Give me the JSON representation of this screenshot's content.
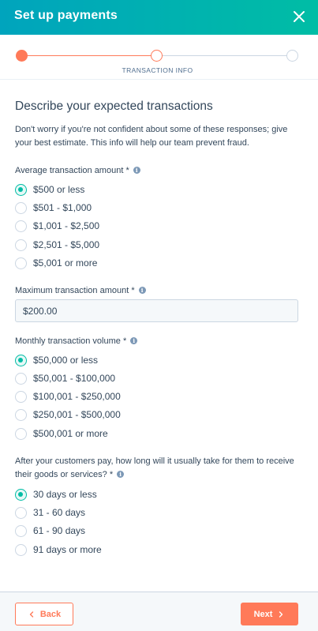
{
  "header": {
    "title": "Set up payments",
    "close_icon": "close-icon"
  },
  "stepper": {
    "current_step_label": "TRANSACTION INFO",
    "colors": {
      "done": "#ff7a59",
      "todo": "#cbd6e2"
    }
  },
  "main": {
    "heading": "Describe your expected transactions",
    "intro": "Don't worry if you're not confident about some of these responses; give your best estimate. This info will help our team prevent fraud.",
    "average_amount": {
      "label": "Average transaction amount *",
      "options": [
        "$500 or less",
        "$501 - $1,000",
        "$1,001 - $2,500",
        "$2,501 - $5,000",
        "$5,001 or more"
      ],
      "selected": "$500 or less"
    },
    "maximum_amount": {
      "label": "Maximum transaction amount *",
      "value": "$200.00"
    },
    "monthly_volume": {
      "label": "Monthly transaction volume *",
      "options": [
        "$50,000 or less",
        "$50,001 - $100,000",
        "$100,001 - $250,000",
        "$250,001 - $500,000",
        "$500,001 or more"
      ],
      "selected": "$50,000 or less"
    },
    "delivery_time": {
      "label_line1": "After your customers pay, how long will it usually take for them to receive",
      "label_line2": "their goods or services? *",
      "options": [
        "30 days or less",
        "31 - 60 days",
        "61 - 90 days",
        "91 days or more"
      ],
      "selected": "30 days or less"
    }
  },
  "footer": {
    "back_label": "Back",
    "next_label": "Next"
  },
  "colors": {
    "accent": "#ff7a59",
    "radio_checked": "#00bda5",
    "header_start": "#00a4bd",
    "header_end": "#00bda5"
  }
}
